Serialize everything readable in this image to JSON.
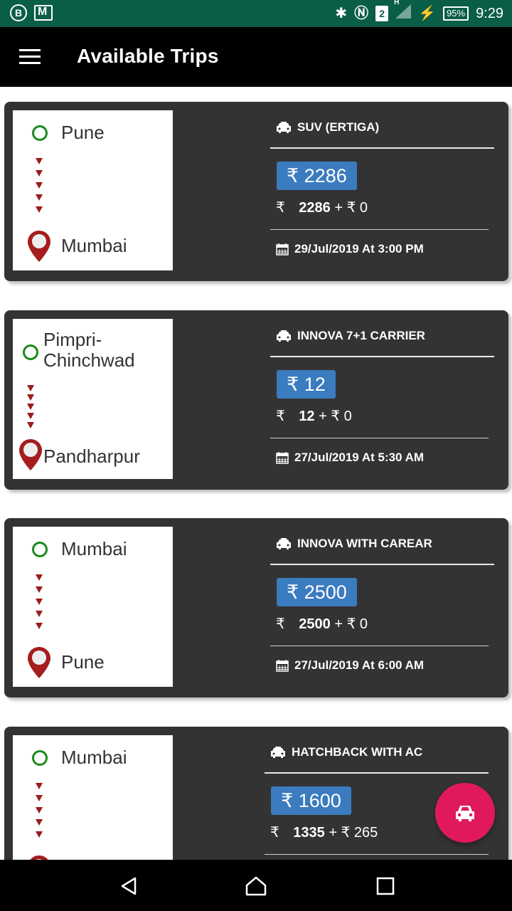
{
  "status_bar": {
    "left_icons": [
      "b-badge-icon",
      "mail-icon"
    ],
    "badge_letter": "B",
    "sim_number": "2",
    "network_type": "H",
    "battery": "95%",
    "time": "9:29"
  },
  "app_bar": {
    "title": "Available Trips",
    "menu_icon": "hamburger-menu-icon"
  },
  "currency_symbol": "₹",
  "trips": [
    {
      "origin": "Pune",
      "destination": "Mumbai",
      "vehicle": "SUV (ERTIGA)",
      "fare": "₹ 2286",
      "base": "2286",
      "extra": "+ ₹ 0",
      "date": "29/Jul/2019 At 3:00 PM"
    },
    {
      "origin": "Pimpri-\nChinchwad",
      "destination": "Pandharpur",
      "vehicle": "INNOVA 7+1 CARRIER",
      "fare": "₹ 12",
      "base": "12",
      "extra": "+ ₹ 0",
      "date": "27/Jul/2019 At 5:30 AM"
    },
    {
      "origin": "Mumbai",
      "destination": "Pune",
      "vehicle": "INNOVA WITH CAREAR",
      "fare": "₹ 2500",
      "base": "2500",
      "extra": "+ ₹ 0",
      "date": "27/Jul/2019 At 6:00 AM"
    },
    {
      "origin": "Mumbai",
      "destination": "",
      "vehicle": "HATCHBACK WITH AC",
      "fare": "₹ 1600",
      "base": "1335",
      "extra": "+ ₹ 265",
      "date": ""
    }
  ],
  "fab": {
    "icon": "car-icon"
  },
  "nav_bar": {
    "icons": [
      "back-icon",
      "home-icon",
      "recents-icon"
    ]
  },
  "colors": {
    "status_bar": "#0a5d46",
    "app_bar": "#000000",
    "card": "#333333",
    "fare_badge": "#3b7bbf",
    "origin_dot": "#1a8a1a",
    "route_arrow": "#9b1b1b",
    "fab": "#e0195f"
  }
}
